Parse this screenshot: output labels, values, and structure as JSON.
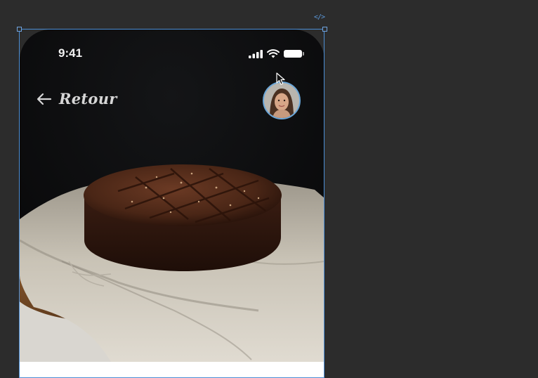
{
  "editor": {
    "code_tag": "</>"
  },
  "status_bar": {
    "time": "9:41",
    "icons": [
      "signal-icon",
      "wifi-icon",
      "battery-icon"
    ]
  },
  "nav": {
    "back_label": "Retour",
    "back_icon": "arrow-left-icon"
  },
  "profile": {
    "avatar_icon": "avatar",
    "border_color": "#6aa6d8"
  },
  "hero": {
    "image": "chocolate-cake-photo"
  },
  "colors": {
    "canvas": "#2c2c2c",
    "selection": "#4d8fd6",
    "screen_bg": "#0b0b0c"
  }
}
